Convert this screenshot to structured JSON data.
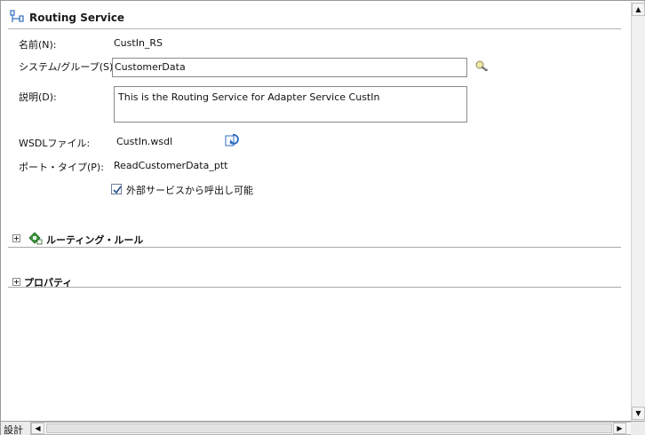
{
  "header": {
    "title": "Routing Service"
  },
  "form": {
    "name_label": "名前(N):",
    "name_value": "CustIn_RS",
    "system_group_label": "システム/グループ(S):",
    "system_group_value": "CustomerData",
    "description_label": "説明(D):",
    "description_value": "This is the Routing Service for Adapter Service CustIn",
    "wsdl_label": "WSDLファイル:",
    "wsdl_value": "CustIn.wsdl",
    "port_type_label": "ポート・タイプ(P):",
    "port_type_value": "ReadCustomerData_ptt",
    "external_call_label": "外部サービスから呼出し可能",
    "external_call_checked": true
  },
  "sections": {
    "routing_rules_label": "ルーティング・ルール",
    "properties_label": "プロパティ"
  },
  "footer": {
    "design_tab_label": "設計"
  },
  "icons": {
    "header": "routing-service-icon",
    "system_group_browse": "flashlight-icon",
    "wsdl_refresh": "refresh-wsdl-icon",
    "routing_rules": "routing-rules-icon"
  },
  "colors": {
    "accent_blue": "#2f6fbf",
    "rule_green": "#3b9a3b",
    "divider": "#b4b4b4"
  }
}
